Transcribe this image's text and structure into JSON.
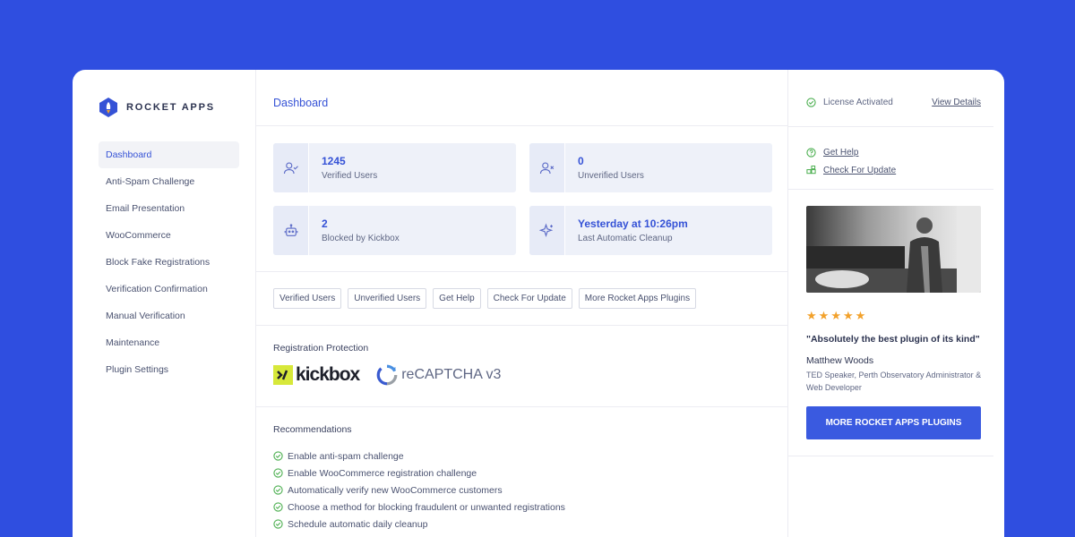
{
  "brand": {
    "name": "ROCKET APPS"
  },
  "sidebar": {
    "items": [
      {
        "label": "Dashboard"
      },
      {
        "label": "Anti-Spam Challenge"
      },
      {
        "label": "Email Presentation"
      },
      {
        "label": "WooCommerce"
      },
      {
        "label": "Block Fake Registrations"
      },
      {
        "label": "Verification Confirmation"
      },
      {
        "label": "Manual Verification"
      },
      {
        "label": "Maintenance"
      },
      {
        "label": "Plugin Settings"
      }
    ]
  },
  "main": {
    "title": "Dashboard",
    "stats": [
      {
        "value": "1245",
        "label": "Verified Users",
        "icon": "user-check-icon"
      },
      {
        "value": "0",
        "label": "Unverified Users",
        "icon": "user-x-icon"
      },
      {
        "value": "2",
        "label": "Blocked by Kickbox",
        "icon": "robot-icon"
      },
      {
        "value": "Yesterday at 10:26pm",
        "label": "Last Automatic Cleanup",
        "icon": "sparkles-icon"
      }
    ],
    "quick_links": [
      "Verified Users",
      "Unverified Users",
      "Get Help",
      "Check For Update",
      "More Rocket Apps Plugins"
    ],
    "registration_protection": {
      "title": "Registration Protection",
      "providers": [
        "kickbox",
        "reCAPTCHA v3"
      ]
    },
    "recommendations": {
      "title": "Recommendations",
      "items": [
        "Enable anti-spam challenge",
        "Enable WooCommerce registration challenge",
        "Automatically verify new WooCommerce customers",
        "Choose a method for blocking fraudulent or unwanted registrations",
        "Schedule automatic daily cleanup"
      ]
    }
  },
  "right": {
    "license_label": "License Activated",
    "view_details": "View Details",
    "help_links": [
      "Get Help",
      "Check For Update"
    ],
    "rating": 5,
    "quote": "\"Absolutely the best plugin of its kind\"",
    "author": "Matthew Woods",
    "author_role": "TED Speaker, Perth Observatory Administrator & Web Developer",
    "cta": "MORE ROCKET APPS PLUGINS"
  },
  "colors": {
    "background": "#2f4ee0",
    "accent": "#3552d6",
    "success": "#4caf50",
    "star": "#f2a12b"
  }
}
